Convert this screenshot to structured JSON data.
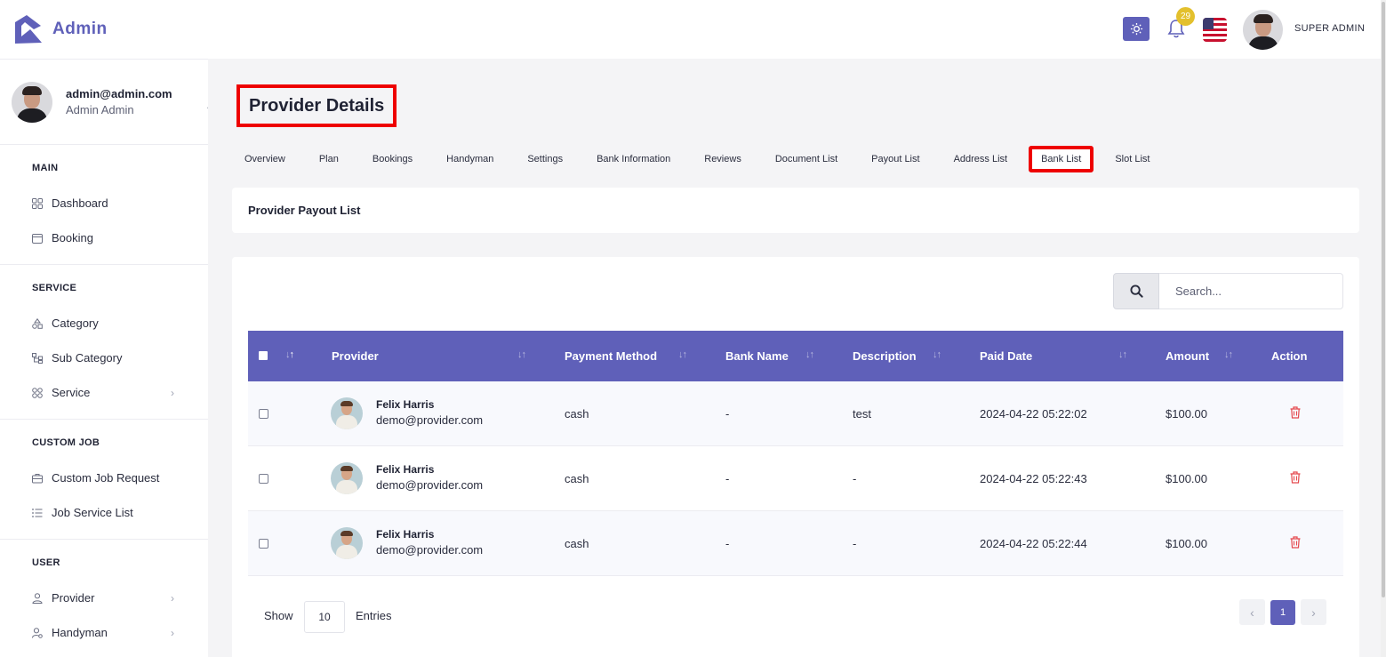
{
  "brand": {
    "name": "Admin"
  },
  "profile": {
    "email": "admin@admin.com",
    "name": "Admin Admin"
  },
  "sidebar": {
    "sections": [
      {
        "title": "MAIN",
        "items": [
          {
            "label": "Dashboard",
            "icon": "grid-icon"
          },
          {
            "label": "Booking",
            "icon": "calendar-icon"
          }
        ]
      },
      {
        "title": "SERVICE",
        "items": [
          {
            "label": "Category",
            "icon": "shapes-icon"
          },
          {
            "label": "Sub Category",
            "icon": "hierarchy-icon"
          },
          {
            "label": "Service",
            "icon": "grid-icon",
            "has_children": true
          }
        ]
      },
      {
        "title": "CUSTOM JOB",
        "items": [
          {
            "label": "Custom Job Request",
            "icon": "briefcase-icon"
          },
          {
            "label": "Job Service List",
            "icon": "list-icon"
          }
        ]
      },
      {
        "title": "USER",
        "items": [
          {
            "label": "Provider",
            "icon": "user-icon",
            "has_children": true
          },
          {
            "label": "Handyman",
            "icon": "user-gear-icon",
            "has_children": true
          }
        ]
      }
    ]
  },
  "topbar": {
    "notification_count": "29",
    "user_label": "SUPER ADMIN",
    "accent": "#5f60b9"
  },
  "page": {
    "title": "Provider Details"
  },
  "tabs": [
    "Overview",
    "Plan",
    "Bookings",
    "Handyman",
    "Settings",
    "Bank Information",
    "Reviews",
    "Document List",
    "Payout List",
    "Address List",
    "Bank List",
    "Slot List"
  ],
  "active_tab": "Bank List",
  "payout_card": {
    "title": "Provider Payout List"
  },
  "search": {
    "placeholder": "Search..."
  },
  "table": {
    "columns": [
      "Provider",
      "Payment Method",
      "Bank Name",
      "Description",
      "Paid Date",
      "Amount",
      "Action"
    ],
    "rows": [
      {
        "name": "Felix Harris",
        "email": "demo@provider.com",
        "method": "cash",
        "bank": "-",
        "description": "test",
        "date": "2024-04-22 05:22:02",
        "amount": "$100.00"
      },
      {
        "name": "Felix Harris",
        "email": "demo@provider.com",
        "method": "cash",
        "bank": "-",
        "description": "-",
        "date": "2024-04-22 05:22:43",
        "amount": "$100.00"
      },
      {
        "name": "Felix Harris",
        "email": "demo@provider.com",
        "method": "cash",
        "bank": "-",
        "description": "-",
        "date": "2024-04-22 05:22:44",
        "amount": "$100.00"
      }
    ]
  },
  "footer": {
    "show_label": "Show",
    "page_size": "10",
    "entries_label": "Entries",
    "current_page": "1"
  }
}
